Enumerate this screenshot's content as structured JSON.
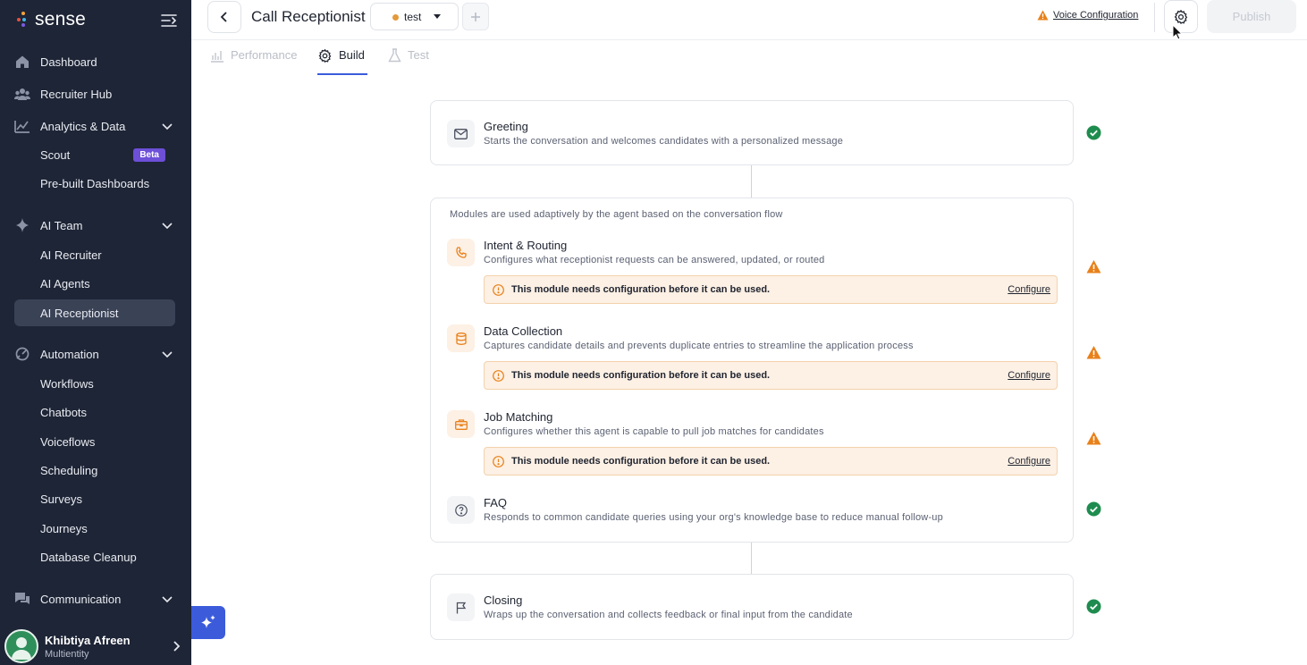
{
  "brand": {
    "name": "sense"
  },
  "sidebar": {
    "items": [
      {
        "label": "Dashboard",
        "icon": "home-icon"
      },
      {
        "label": "Recruiter Hub",
        "icon": "people-icon"
      },
      {
        "label": "Analytics & Data",
        "icon": "chart-icon",
        "expanded": true,
        "children": [
          {
            "label": "Scout",
            "badge": "Beta"
          },
          {
            "label": "Pre-built Dashboards"
          }
        ]
      },
      {
        "label": "AI Team",
        "icon": "sparkle-icon",
        "expanded": true,
        "children": [
          {
            "label": "AI Recruiter"
          },
          {
            "label": "AI Agents"
          },
          {
            "label": "AI Receptionist",
            "active": true
          }
        ]
      },
      {
        "label": "Automation",
        "icon": "automation-icon",
        "expanded": true,
        "children": [
          {
            "label": "Workflows"
          },
          {
            "label": "Chatbots"
          },
          {
            "label": "Voiceflows"
          },
          {
            "label": "Scheduling"
          },
          {
            "label": "Surveys"
          },
          {
            "label": "Journeys"
          },
          {
            "label": "Database Cleanup"
          }
        ]
      },
      {
        "label": "Communication",
        "icon": "chat-icon",
        "expanded": false
      }
    ],
    "user": {
      "name": "Khibtiya Afreen",
      "org": "Multientity"
    }
  },
  "header": {
    "title": "Call Receptionist",
    "version": "test",
    "voice_config_label": "Voice Configuration",
    "publish_label": "Publish"
  },
  "tabs": [
    {
      "label": "Performance",
      "state": "disabled"
    },
    {
      "label": "Build",
      "state": "active"
    },
    {
      "label": "Test",
      "state": "disabled"
    }
  ],
  "flow": {
    "greeting": {
      "title": "Greeting",
      "description": "Starts the conversation and welcomes candidates with a personalized message",
      "status": "complete"
    },
    "modules_note": "Modules are used adaptively by the agent based on the conversation flow",
    "modules": [
      {
        "title": "Intent & Routing",
        "description": "Configures what receptionist requests can be answered, updated, or routed",
        "status": "warning",
        "alert": "This module needs configuration before it can be used.",
        "alert_action": "Configure"
      },
      {
        "title": "Data Collection",
        "description": "Captures candidate details and prevents duplicate entries to streamline the application process",
        "status": "warning",
        "alert": "This module needs configuration before it can be used.",
        "alert_action": "Configure"
      },
      {
        "title": "Job Matching",
        "description": "Configures whether this agent is capable to pull job matches for candidates",
        "status": "warning",
        "alert": "This module needs configuration before it can be used.",
        "alert_action": "Configure"
      },
      {
        "title": "FAQ",
        "description": "Responds to common candidate queries using your org's knowledge base to reduce manual follow-up",
        "status": "complete"
      }
    ],
    "closing": {
      "title": "Closing",
      "description": "Wraps up the conversation and collects feedback or final input from the candidate",
      "status": "complete"
    }
  },
  "colors": {
    "sidebar_bg": "#1e2536",
    "accent": "#3b5bdb",
    "warning": "#e8811a",
    "success": "#1e8c4e",
    "beta": "#6d4fd8"
  }
}
